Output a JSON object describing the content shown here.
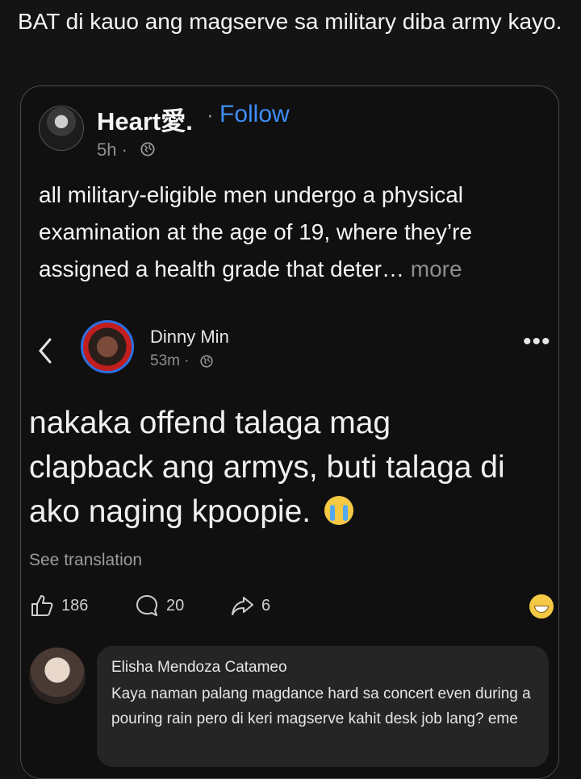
{
  "post": {
    "text": "BAT di kauo ang magserve sa military diba army kayo."
  },
  "quoted": {
    "author": "Heart愛.",
    "separator": "·",
    "follow_label": "Follow",
    "time": "5h ·",
    "text": "all military‑eligible men undergo a physical examination at the age of 19, where they’re assigned a health grade that deter…",
    "more_label": "more"
  },
  "screenshot": {
    "author": "Dinny Min",
    "time": "53m ·",
    "more_label": "•••",
    "text": "nakaka offend talaga mag clapback ang armys, buti talaga di ako naging kpoopie.",
    "see_translation": "See translation",
    "likes": "186",
    "comments": "20",
    "shares": "6",
    "comment": {
      "author": "Elisha Mendoza Catameo",
      "text": "Kaya naman palang magdance hard sa concert even during a pouring rain pero di keri magserve kahit desk job lang? eme"
    }
  },
  "colors": {
    "background": "#141414",
    "accent": "#3e8ef7",
    "muted": "#8f8f8f"
  }
}
